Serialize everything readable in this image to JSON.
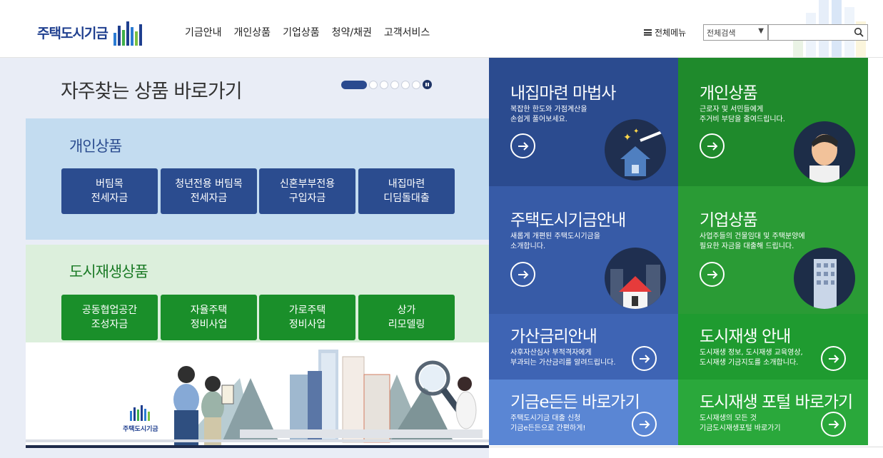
{
  "header": {
    "logo_text": "주택도시기금",
    "nav": [
      "기금안내",
      "개인상품",
      "기업상품",
      "청약/채권",
      "고객서비스"
    ],
    "all_menu": "전체메뉴",
    "search_select": "전체검색",
    "search_placeholder": ""
  },
  "quick": {
    "title": "자주찾는 상품 바로가기",
    "personal_title": "개인상품",
    "personal_items": [
      "버팀목\n전세자금",
      "청년전용 버팀목\n전세자금",
      "신혼부부전용\n구입자금",
      "내집마련\n디딤돌대출"
    ],
    "urban_title": "도시재생상품",
    "urban_items": [
      "공동협업공간\n조성자금",
      "자율주택\n정비사업",
      "가로주택\n정비사업",
      "상가\n리모델링"
    ],
    "illus_logo": "주택도시기금"
  },
  "tiles": [
    {
      "title": "내집마련 마법사",
      "desc": "복잡한 한도와 가점계산을\n손쉽게 풀어보세요."
    },
    {
      "title": "개인상품",
      "desc": "근로자 및 서민들에게\n주거비 부담을 줄여드립니다."
    },
    {
      "title": "주택도시기금안내",
      "desc": "새롭게 개편된 주택도시기금을\n소개합니다."
    },
    {
      "title": "기업상품",
      "desc": "사업주들의 건물임대 및 주택분양에\n필요한 자금을 대출해 드립니다."
    },
    {
      "title": "가산금리안내",
      "desc": "사후자산심사 부적격자에게\n부과되는 가산금리를 알려드립니다."
    },
    {
      "title": "도시재생 안내",
      "desc": "도시재생 정보, 도시재생 교육영상,\n도시재생 기금지도를 소개합니다."
    },
    {
      "title": "기금e든든 바로가기",
      "desc": "주택도시기금 대출 신청\n기금e든든으로 간편하게!"
    },
    {
      "title": "도시재생 포털 바로가기",
      "desc": "도시재생의 모든 것\n기금도시재생포털 바로가기"
    }
  ],
  "colors": {
    "navy": "#2b4c8f",
    "green": "#1a8f2a",
    "tile_blue1": "#2b4b8f",
    "tile_green1": "#1f8a2c",
    "tile_blue2": "#375ba7",
    "tile_green2": "#2a9b35",
    "tile_blue3": "#4b72c5",
    "tile_green3": "#37ac3e"
  }
}
